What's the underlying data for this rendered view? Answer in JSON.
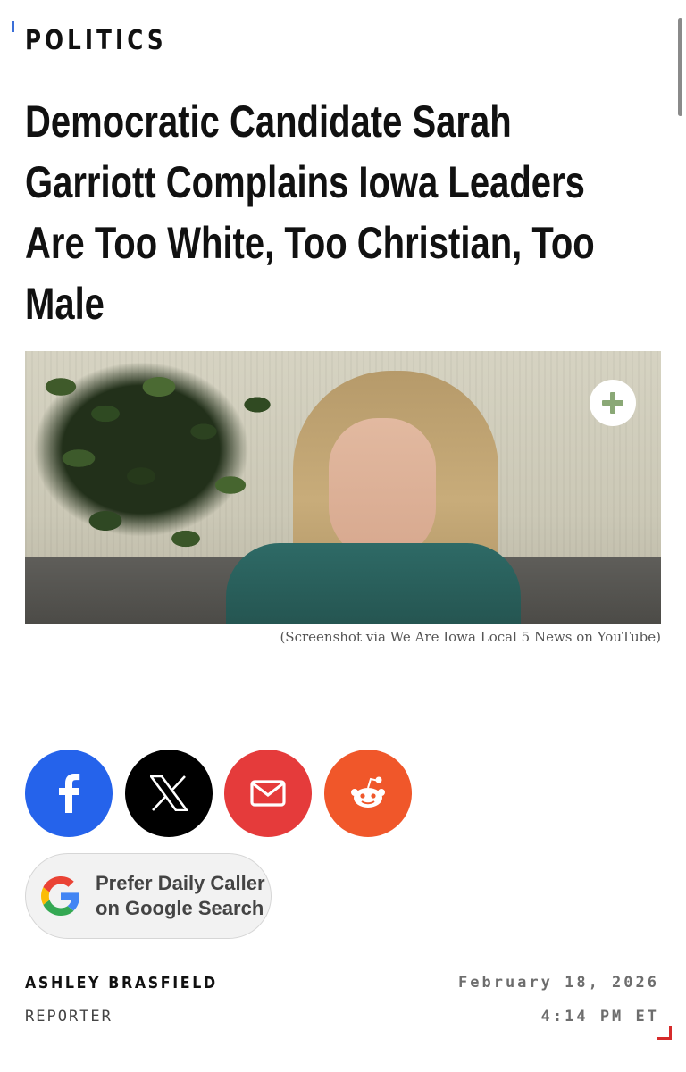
{
  "category": "POLITICS",
  "headline": {
    "line1": "Democratic Candidate Sarah",
    "line2": "Garriott Complains Iowa Leaders",
    "line3": "Are Too White, Too Christian, Too",
    "line4": "Male"
  },
  "image": {
    "caption": "(Screenshot via We Are Iowa Local 5 News on YouTube)",
    "expand_icon": "plus-circle-icon"
  },
  "share": {
    "facebook_icon": "facebook-icon",
    "x_icon": "x-icon",
    "email_icon": "email-icon",
    "reddit_icon": "reddit-icon",
    "colors": {
      "facebook": "#2563eb",
      "x": "#000000",
      "email": "#e53b3b",
      "reddit": "#f0572a"
    }
  },
  "google_pref": {
    "line1": "Prefer Daily Caller",
    "line2": "on Google Search",
    "icon": "google-icon"
  },
  "byline": {
    "author": "ASHLEY BRASFIELD",
    "role": "REPORTER",
    "date": "February 18, 2026",
    "time": "4:14 PM ET"
  },
  "colors": {
    "accent_red": "#d62b2b",
    "accent_blue": "#3b6fd8"
  }
}
